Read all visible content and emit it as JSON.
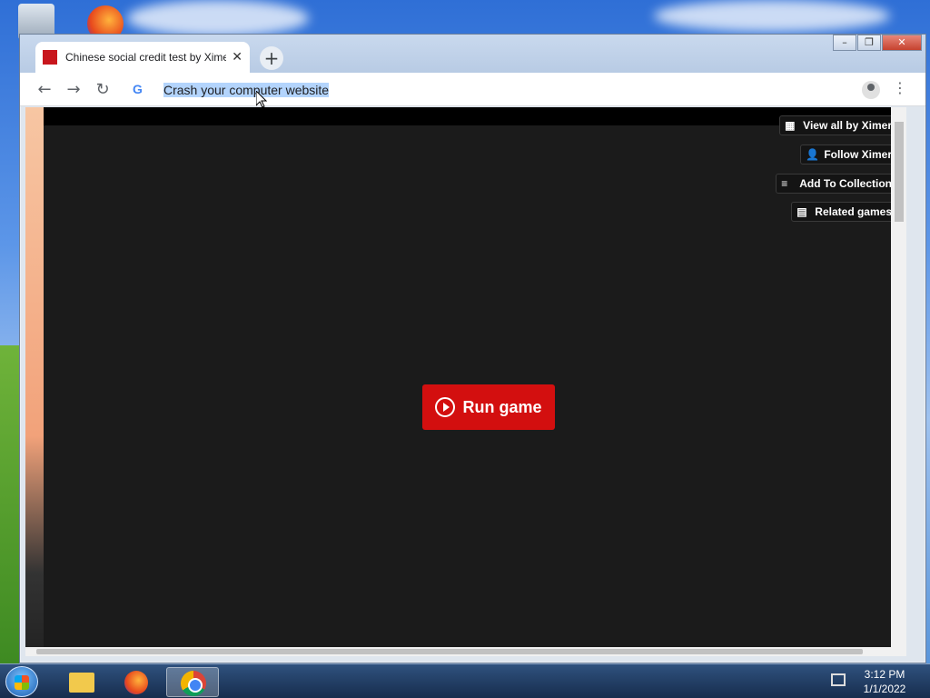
{
  "browser": {
    "tab": {
      "title": "Chinese social credit test by Ximer",
      "favicon_color": "#c8161d"
    },
    "new_tab_label": "+",
    "address_bar": {
      "text": "Crash your computer website",
      "search_engine_icon": "G"
    },
    "window_controls": {
      "minimize": "–",
      "maximize": "❐",
      "close": "✕"
    }
  },
  "page": {
    "side_buttons": [
      {
        "label": "View all by Ximer",
        "icon": "store-icon"
      },
      {
        "label": "Follow Ximer",
        "icon": "user-plus-icon"
      },
      {
        "label": "Add To Collection",
        "icon": "playlist-add-icon"
      },
      {
        "label": "Related games",
        "icon": "map-icon"
      }
    ],
    "run_button": {
      "label": "Run game",
      "color": "#d30f0f"
    }
  },
  "taskbar": {
    "clock_time": "3:12 PM",
    "clock_date": "1/1/2022",
    "apps": [
      "file-explorer",
      "firefox",
      "chrome"
    ]
  }
}
